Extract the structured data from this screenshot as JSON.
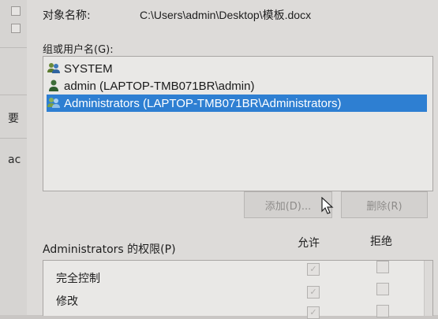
{
  "background_window": {
    "label_1": "要",
    "label_2": "ac"
  },
  "dialog": {
    "object_name_label": "对象名称:",
    "object_name_value": "C:\\Users\\admin\\Desktop\\模板.docx",
    "group_label": "组或用户名(G):",
    "principals": [
      {
        "name": "SYSTEM",
        "icon": "group-users-icon",
        "selected": false
      },
      {
        "name": "admin (LAPTOP-TMB071BR\\admin)",
        "icon": "user-icon",
        "selected": false
      },
      {
        "name": "Administrators (LAPTOP-TMB071BR\\Administrators)",
        "icon": "group-users-icon",
        "selected": true
      }
    ],
    "add_button": "添加(D)...",
    "remove_button": "删除(R)",
    "permissions_title": "Administrators 的权限(P)",
    "allow_header": "允许",
    "deny_header": "拒绝",
    "permissions": [
      {
        "name": "完全控制",
        "allow": true,
        "deny": false
      },
      {
        "name": "修改",
        "allow": true,
        "deny": false
      },
      {
        "name": "",
        "allow": true,
        "deny": false
      }
    ]
  },
  "colors": {
    "selection": "#2e7fd2",
    "dialog_bg": "#dddbd9",
    "list_bg": "#e9e8e6"
  }
}
